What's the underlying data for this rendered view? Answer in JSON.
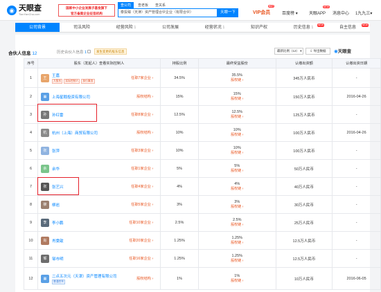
{
  "brand": {
    "name": "天眼查",
    "domain": "TianYanCha.com",
    "slogan_line1": "国家中小企业发展子基金旗下",
    "slogan_line2": "官方备案企业征信机构"
  },
  "search": {
    "tabs": [
      "查公司",
      "查老板",
      "查关系"
    ],
    "value": "泰投臻（天津）资产管理合伙企业（有限合伙）",
    "button": "天眼一下"
  },
  "nav": {
    "vip": "VIP会员",
    "hot": "HOT",
    "items": [
      "百度榜",
      "天眼APP",
      "消息中心",
      "1九九三"
    ],
    "new": "NEW"
  },
  "tabs": [
    {
      "label": "公司背景",
      "count": "",
      "active": true
    },
    {
      "label": "司法风险",
      "count": "",
      "active": false
    },
    {
      "label": "经营风险",
      "count": "1",
      "active": false
    },
    {
      "label": "公司发展",
      "count": "",
      "active": false
    },
    {
      "label": "经营状况",
      "count": "1",
      "active": false
    },
    {
      "label": "知识产权",
      "count": "",
      "active": false
    },
    {
      "label": "历史信息",
      "count": "1",
      "active": false
    },
    {
      "label": "自主信息",
      "count": "",
      "active": false
    }
  ],
  "tab_badges": [
    "NEW",
    "NEW"
  ],
  "section": {
    "title": "合伙人信息",
    "count": "12",
    "history": "历史合伙人信息",
    "history_count": "1",
    "related": "发生变更的股东信息",
    "sort": "最新比例（12）",
    "export": "导出数据",
    "logo": "天眼查"
  },
  "table": {
    "headers": [
      "序号",
      "股东（发起人）查看实际控制人",
      "持股比例",
      "最终受益股份",
      "认缴出资额",
      "认缴出资日期"
    ],
    "rows": [
      {
        "idx": "1",
        "name": "王嘉",
        "avatar": "王",
        "avatar_color": "#e8a56b",
        "tags": [
          "大股东",
          "实际控制人",
          "执行事务"
        ],
        "job": "任职7家企业",
        "ratio": "34.5%",
        "final": "35.5%",
        "chain": "股权链",
        "capital": "345万人民币",
        "date": "-"
      },
      {
        "idx": "2",
        "name": "上海星翰投资有限公司",
        "avatar": "",
        "avatar_color": "#5aa0e6",
        "tags": [],
        "job": "股权结构",
        "ratio": "15%",
        "final": "15%",
        "chain": "股权链",
        "capital": "150万人民币",
        "date": "2016-04-26"
      },
      {
        "idx": "3",
        "name": "孙红雷",
        "avatar": "孙",
        "avatar_color": "#777777",
        "tags": [],
        "job": "任职8家企业",
        "ratio": "12.5%",
        "final": "12.5%",
        "chain": "股权链",
        "capital": "125万人民币",
        "date": "-"
      },
      {
        "idx": "4",
        "name": "杭州（上海）商贸有限公司",
        "avatar": "杭",
        "avatar_color": "#8a8a8a",
        "tags": [],
        "job": "股权结构",
        "ratio": "10%",
        "final": "10%",
        "chain": "股权链",
        "capital": "100万人民币",
        "date": "2016-04-26"
      },
      {
        "idx": "5",
        "name": "张萍",
        "avatar": "张",
        "avatar_color": "#8fb3e0",
        "tags": [],
        "job": "任职3家企业",
        "ratio": "10%",
        "final": "10%",
        "chain": "股权链",
        "capital": "100万人民币",
        "date": "-"
      },
      {
        "idx": "6",
        "name": "余华",
        "avatar": "余",
        "avatar_color": "#7ac58b",
        "tags": [],
        "job": "任职1家企业",
        "ratio": "5%",
        "final": "5%",
        "chain": "股权链",
        "capital": "50万人民币",
        "date": "-"
      },
      {
        "idx": "7",
        "name": "张艺兴",
        "avatar": "张",
        "avatar_color": "#555555",
        "tags": [],
        "job": "任职4家企业",
        "ratio": "4%",
        "final": "4%",
        "chain": "股权链",
        "capital": "40万人民币",
        "date": "-"
      },
      {
        "idx": "8",
        "name": "柳岩",
        "avatar": "柳",
        "avatar_color": "#9a7f6e",
        "tags": [],
        "job": "任职5家企业",
        "ratio": "3%",
        "final": "3%",
        "chain": "股权链",
        "capital": "30万人民币",
        "date": "-"
      },
      {
        "idx": "9",
        "name": "李小鹏",
        "avatar": "李",
        "avatar_color": "#5a6a7a",
        "tags": [],
        "job": "任职10家企业",
        "ratio": "2.5%",
        "final": "2.5%",
        "chain": "股权链",
        "capital": "25万人民币",
        "date": "-"
      },
      {
        "idx": "10",
        "name": "肖雯歆",
        "avatar": "肖",
        "avatar_color": "#b07a60",
        "tags": [],
        "job": "任职20家企业",
        "ratio": "1.25%",
        "final": "1.25%",
        "chain": "股权链",
        "capital": "12.5万人民币",
        "date": "-"
      },
      {
        "idx": "11",
        "name": "邹市明",
        "avatar": "邹",
        "avatar_color": "#6d6d6d",
        "tags": [],
        "job": "任职16家企业",
        "ratio": "1.25%",
        "final": "1.25%",
        "chain": "股权链",
        "capital": "12.5万人民币",
        "date": "-"
      },
      {
        "idx": "12",
        "name": "二点五次元（天津）资产管理有限公司",
        "avatar": "",
        "avatar_color": "#5aa0e6",
        "tags": [
          "普通合伙"
        ],
        "job": "股权结构",
        "ratio": "1%",
        "final": "1%",
        "chain": "股权链",
        "capital": "10万人民币",
        "date": "2016-06-05"
      }
    ]
  }
}
